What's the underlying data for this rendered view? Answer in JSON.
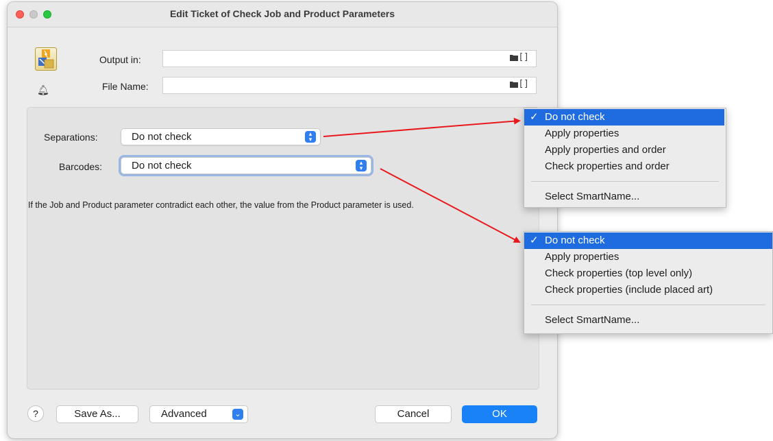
{
  "window": {
    "title": "Edit Ticket of Check Job and Product Parameters",
    "traffic_lights": {
      "close": "#fe5f57",
      "minimize": "#c9c9c9",
      "zoom": "#28c840"
    }
  },
  "output": {
    "label": "Output in:",
    "value": "",
    "folder_icon": "folder-icon",
    "bracket": "[]"
  },
  "filename": {
    "label": "File Name:",
    "value": "",
    "folder_icon": "folder-icon",
    "bracket": "[]"
  },
  "separations": {
    "label": "Separations:",
    "value": "Do not check"
  },
  "barcodes": {
    "label": "Barcodes:",
    "value": "Do not check"
  },
  "note": "If the Job and Product parameter contradict each other, the value from the Product parameter is used.",
  "buttons": {
    "help": "?",
    "save_as": "Save As...",
    "advanced": "Advanced",
    "cancel": "Cancel",
    "ok": "OK"
  },
  "separations_menu": {
    "checkmark": "✓",
    "items": [
      "Do not check",
      "Apply properties",
      "Apply properties and order",
      "Check properties and order"
    ],
    "smartname": "Select SmartName..."
  },
  "barcodes_menu": {
    "checkmark": "✓",
    "items": [
      "Do not check",
      "Apply properties",
      "Check properties (top level only)",
      "Check properties (include placed art)"
    ],
    "smartname": "Select SmartName..."
  },
  "colors": {
    "accent": "#1a82f7",
    "menu_selection": "#1f6ce0",
    "arrow": "#e8191d"
  }
}
